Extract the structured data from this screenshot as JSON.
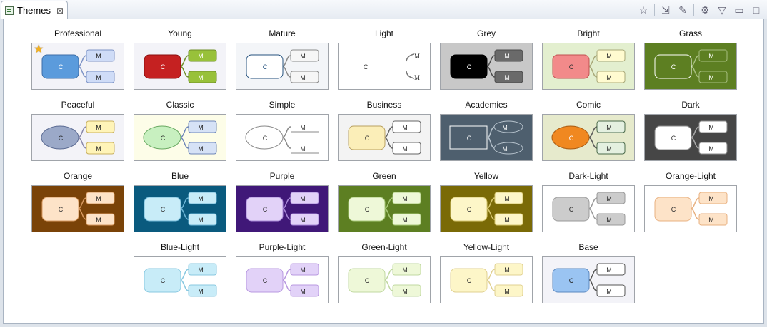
{
  "tab": {
    "title": "Themes",
    "close_label": "⊠"
  },
  "toolbar": {
    "items": [
      {
        "name": "favorite-star-icon",
        "glyph": "☆"
      },
      {
        "name": "import-theme-icon",
        "glyph": "⇲"
      },
      {
        "name": "edit-theme-icon",
        "glyph": "✎"
      },
      {
        "name": "properties-icon",
        "glyph": "⚙"
      },
      {
        "name": "view-menu-icon",
        "glyph": "▽"
      },
      {
        "name": "minimize-icon",
        "glyph": "▭"
      },
      {
        "name": "maximize-icon",
        "glyph": "□"
      }
    ]
  },
  "central_label": "C",
  "main_label": "M",
  "themes": [
    {
      "name": "Professional",
      "favorite": true,
      "bg": "#f3f3f8",
      "cFill": "#5b9bdc",
      "cStroke": "#3c6ea8",
      "cText": "#ffffff",
      "cShape": "rect",
      "mFill": "#cfdcf7",
      "mStroke": "#7d93c6",
      "mText": "#222222",
      "line": "#7d93c6",
      "mStyle": "box"
    },
    {
      "name": "Young",
      "bg": "#f3f3f8",
      "cFill": "#c52121",
      "cStroke": "#8a1010",
      "cText": "#ffffff",
      "cShape": "rect",
      "mFill": "#98c13a",
      "mStroke": "#6f8f28",
      "mText": "#ffffff",
      "line": "#6f8f28",
      "mStyle": "box"
    },
    {
      "name": "Mature",
      "bg": "#f3f5f8",
      "cFill": "#ffffff",
      "cStroke": "#24517e",
      "cText": "#24517e",
      "cShape": "rect",
      "mFill": "#f6f6f6",
      "mStroke": "#8a8a8a",
      "mText": "#222222",
      "line": "#8a8a8a",
      "mStyle": "box"
    },
    {
      "name": "Light",
      "bg": "#ffffff",
      "cFill": "none",
      "cStroke": "none",
      "cText": "#333333",
      "cShape": "none",
      "mFill": "none",
      "mStroke": "none",
      "mText": "#333333",
      "line": "#777777",
      "mStyle": "text"
    },
    {
      "name": "Grey",
      "bg": "#c8c8c8",
      "cFill": "#000000",
      "cStroke": "#000000",
      "cText": "#ffffff",
      "cShape": "rect",
      "mFill": "#6a6a6a",
      "mStroke": "#4a4a4a",
      "mText": "#ffffff",
      "line": "#4a4a4a",
      "mStyle": "box"
    },
    {
      "name": "Bright",
      "bg": "#e3efcf",
      "cFill": "#f28a8a",
      "cStroke": "#c05050",
      "cText": "#333333",
      "cShape": "rect",
      "mFill": "#fffbd0",
      "mStroke": "#a8a878",
      "mText": "#222222",
      "line": "#a8a878",
      "mStyle": "box"
    },
    {
      "name": "Grass",
      "bg": "#5d7f22",
      "cFill": "#5d7f22",
      "cStroke": "#ffffff",
      "cText": "#ffffff",
      "cShape": "rect",
      "mFill": "#5d7f22",
      "mStroke": "#a8bf80",
      "mText": "#ffffff",
      "line": "#a8bf80",
      "mStyle": "box"
    },
    {
      "name": "Peaceful",
      "bg": "#f3f3f8",
      "cFill": "#9ba9c8",
      "cStroke": "#5a6a92",
      "cText": "#222222",
      "cShape": "ellipse",
      "mFill": "#fff4b8",
      "mStroke": "#c8b060",
      "mText": "#222222",
      "line": "#8888aa",
      "mStyle": "box"
    },
    {
      "name": "Classic",
      "bg": "#fdfde8",
      "cFill": "#c8f0c0",
      "cStroke": "#68a860",
      "cText": "#222222",
      "cShape": "ellipse",
      "mFill": "#d6e2f6",
      "mStroke": "#6e86b8",
      "mText": "#222222",
      "line": "#6e86b8",
      "mStyle": "box"
    },
    {
      "name": "Simple",
      "bg": "#ffffff",
      "cFill": "#ffffff",
      "cStroke": "#888888",
      "cText": "#333333",
      "cShape": "ellipse",
      "mFill": "none",
      "mStroke": "none",
      "mText": "#333333",
      "line": "#888888",
      "mStyle": "underline"
    },
    {
      "name": "Business",
      "bg": "#f3f3f3",
      "cFill": "#fbeeb8",
      "cStroke": "#b8a060",
      "cText": "#333333",
      "cShape": "rect",
      "mFill": "#ffffff",
      "mStroke": "#666666",
      "mText": "#222222",
      "line": "#666666",
      "mStyle": "box"
    },
    {
      "name": "Academies",
      "bg": "#4e5f6e",
      "cFill": "#4e5f6e",
      "cStroke": "#ffffff",
      "cText": "#ffffff",
      "cShape": "square",
      "mFill": "#4e5f6e",
      "mStroke": "#b8c4ce",
      "mText": "#ffffff",
      "line": "#b8c4ce",
      "mStyle": "ellipse"
    },
    {
      "name": "Comic",
      "bg": "#e6eacc",
      "cFill": "#f08820",
      "cStroke": "#a85a10",
      "cText": "#ffffff",
      "cShape": "ellipse",
      "mFill": "#e4f0e0",
      "mStroke": "#4a6a4a",
      "mText": "#222222",
      "line": "#555555",
      "mStyle": "box"
    },
    {
      "name": "Dark",
      "bg": "#464646",
      "cFill": "#ffffff",
      "cStroke": "#888888",
      "cText": "#333333",
      "cShape": "rect",
      "mFill": "#ffffff",
      "mStroke": "#888888",
      "mText": "#222222",
      "line": "#aaaaaa",
      "mStyle": "box"
    },
    {
      "name": "Orange",
      "bg": "#7a4308",
      "cFill": "#fde3c8",
      "cStroke": "#d89a60",
      "cText": "#333333",
      "cShape": "rect",
      "mFill": "#fde3c8",
      "mStroke": "#d89a60",
      "mText": "#222222",
      "line": "#d89a60",
      "mStyle": "box"
    },
    {
      "name": "Blue",
      "bg": "#0a5a7e",
      "cFill": "#c8ecf8",
      "cStroke": "#70b8d8",
      "cText": "#333333",
      "cShape": "rect",
      "mFill": "#c8ecf8",
      "mStroke": "#70b8d8",
      "mText": "#222222",
      "line": "#70b8d8",
      "mStyle": "box"
    },
    {
      "name": "Purple",
      "bg": "#401878",
      "cFill": "#e2d2f8",
      "cStroke": "#a888d8",
      "cText": "#333333",
      "cShape": "rect",
      "mFill": "#e2d2f8",
      "mStroke": "#a888d8",
      "mText": "#222222",
      "line": "#a888d8",
      "mStyle": "box"
    },
    {
      "name": "Green",
      "bg": "#5d7f22",
      "cFill": "#eef8d8",
      "cStroke": "#a8c878",
      "cText": "#333333",
      "cShape": "rect",
      "mFill": "#eef8d8",
      "mStroke": "#a8c878",
      "mText": "#222222",
      "line": "#a8c878",
      "mStyle": "box"
    },
    {
      "name": "Yellow",
      "bg": "#7a6a06",
      "cFill": "#fdf6c8",
      "cStroke": "#d8c870",
      "cText": "#333333",
      "cShape": "rect",
      "mFill": "#fdf6c8",
      "mStroke": "#d8c870",
      "mText": "#222222",
      "line": "#d8c870",
      "mStyle": "box"
    },
    {
      "name": "Dark-Light",
      "bg": "#ffffff",
      "cFill": "#cccccc",
      "cStroke": "#999999",
      "cText": "#333333",
      "cShape": "rect",
      "mFill": "#cccccc",
      "mStroke": "#999999",
      "mText": "#222222",
      "line": "#999999",
      "mStyle": "box"
    },
    {
      "name": "Orange-Light",
      "bg": "#ffffff",
      "cFill": "#fde3c8",
      "cStroke": "#e8b080",
      "cText": "#333333",
      "cShape": "rect",
      "mFill": "#fde3c8",
      "mStroke": "#e8b080",
      "mText": "#222222",
      "line": "#e8b080",
      "mStyle": "box"
    },
    {
      "name": "Blue-Light",
      "bg": "#ffffff",
      "cFill": "#c8ecf8",
      "cStroke": "#88c8e0",
      "cText": "#333333",
      "cShape": "rect",
      "mFill": "#c8ecf8",
      "mStroke": "#88c8e0",
      "mText": "#222222",
      "line": "#88c8e0",
      "mStyle": "box"
    },
    {
      "name": "Purple-Light",
      "bg": "#ffffff",
      "cFill": "#e2d2f8",
      "cStroke": "#b898e0",
      "cText": "#333333",
      "cShape": "rect",
      "mFill": "#e2d2f8",
      "mStroke": "#b898e0",
      "mText": "#222222",
      "line": "#b898e0",
      "mStyle": "box"
    },
    {
      "name": "Green-Light",
      "bg": "#ffffff",
      "cFill": "#eef8d8",
      "cStroke": "#c0d8a0",
      "cText": "#333333",
      "cShape": "rect",
      "mFill": "#eef8d8",
      "mStroke": "#c0d8a0",
      "mText": "#222222",
      "line": "#c0d8a0",
      "mStyle": "box"
    },
    {
      "name": "Yellow-Light",
      "bg": "#ffffff",
      "cFill": "#fdf6c8",
      "cStroke": "#e0d090",
      "cText": "#333333",
      "cShape": "rect",
      "mFill": "#fdf6c8",
      "mStroke": "#e0d090",
      "mText": "#222222",
      "line": "#e0d090",
      "mStyle": "box"
    },
    {
      "name": "Base",
      "bg": "#f3f3f8",
      "cFill": "#9ac4f2",
      "cStroke": "#5a88c0",
      "cText": "#222222",
      "cShape": "rect",
      "mFill": "#ffffff",
      "mStroke": "#555555",
      "mText": "#222222",
      "line": "#555555",
      "mStyle": "box"
    }
  ]
}
